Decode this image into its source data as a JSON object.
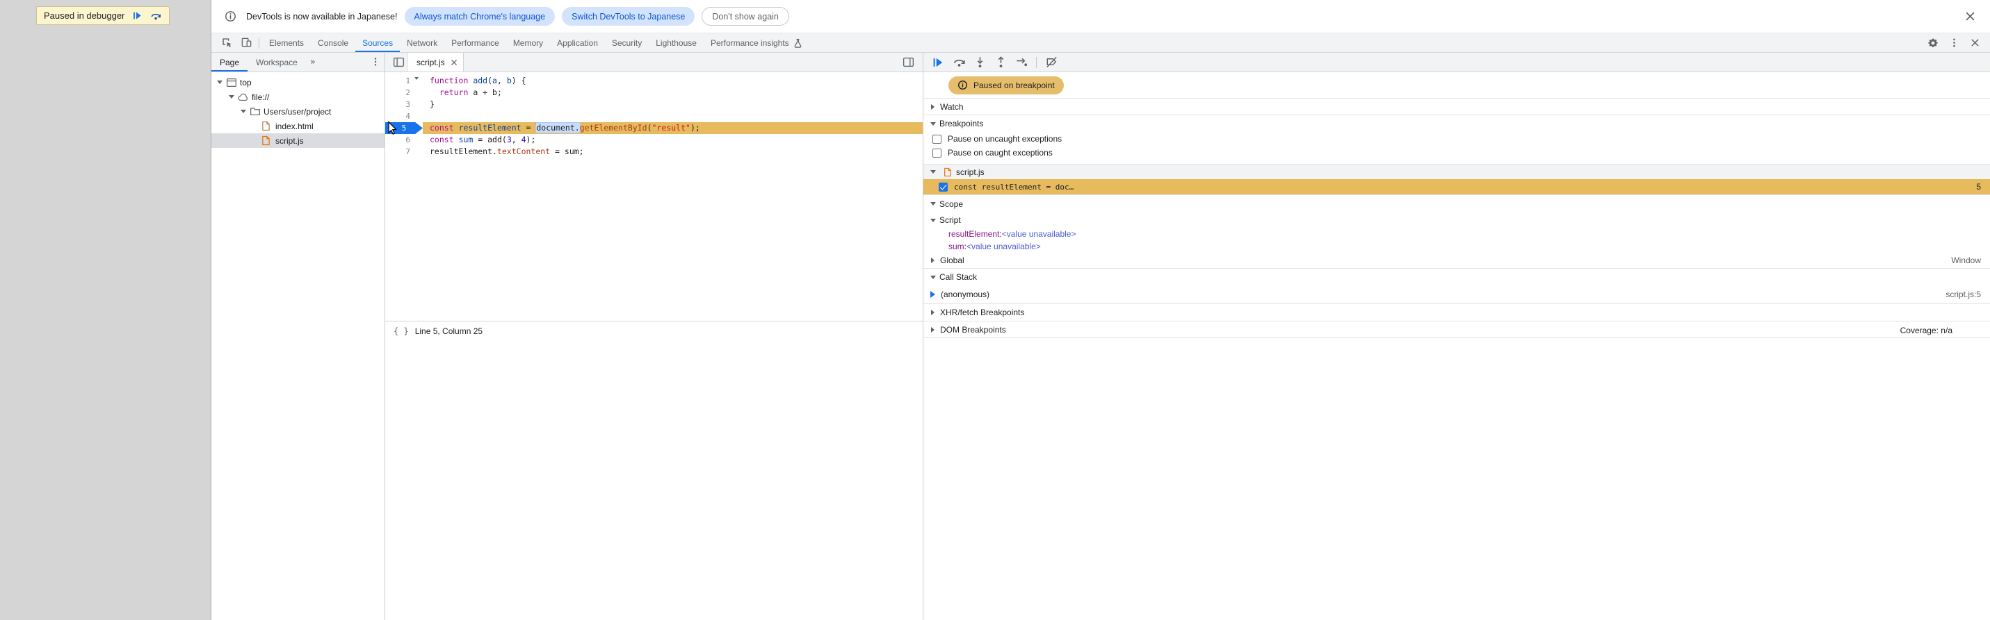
{
  "page": {
    "paused_banner_text": "Paused in debugger"
  },
  "infobar": {
    "message": "DevTools is now available in Japanese!",
    "buttons": [
      {
        "label": "Always match Chrome's language"
      },
      {
        "label": "Switch DevTools to Japanese"
      },
      {
        "label": "Don't show again"
      }
    ]
  },
  "toolbar": {
    "tabs": [
      "Elements",
      "Console",
      "Sources",
      "Network",
      "Performance",
      "Memory",
      "Application",
      "Security",
      "Lighthouse",
      "Performance insights"
    ],
    "selected_tab": "Sources"
  },
  "navigator": {
    "tabs": [
      "Page",
      "Workspace"
    ],
    "selected_tab": "Page",
    "tree": [
      {
        "label": "top",
        "icon": "frame",
        "depth": 0,
        "expanded": true
      },
      {
        "label": "file://",
        "icon": "cloud",
        "depth": 1,
        "expanded": true
      },
      {
        "label": "Users/user/project",
        "icon": "folder",
        "depth": 2,
        "expanded": true
      },
      {
        "label": "index.html",
        "icon": "file",
        "icon_color": "#b08252",
        "depth": 3
      },
      {
        "label": "script.js",
        "icon": "file",
        "icon_color": "#e8710a",
        "depth": 3,
        "selected": true
      }
    ]
  },
  "editor": {
    "tab_label": "script.js",
    "status_line": "Line 5, Column 25",
    "coverage": "Coverage: n/a",
    "lines": [
      {
        "n": 1,
        "fold": true,
        "tokens": [
          [
            "function",
            "kw"
          ],
          [
            " ",
            ""
          ],
          [
            "add",
            "def"
          ],
          [
            "(",
            ""
          ],
          [
            "a",
            "def"
          ],
          [
            ", ",
            ""
          ],
          [
            "b",
            "def"
          ],
          [
            ") {",
            ""
          ]
        ]
      },
      {
        "n": 2,
        "tokens": [
          [
            "  ",
            ""
          ],
          [
            "return",
            "kw"
          ],
          [
            " a + b;",
            ""
          ]
        ]
      },
      {
        "n": 3,
        "tokens": [
          [
            "}",
            ""
          ]
        ]
      },
      {
        "n": 4,
        "tokens": []
      },
      {
        "n": 5,
        "current": true,
        "breakpoint": true,
        "tokens": [
          [
            "const",
            "kw"
          ],
          [
            " ",
            ""
          ],
          [
            "resultElement",
            "def"
          ],
          [
            " = ",
            ""
          ],
          [
            "",
            "caret"
          ],
          [
            "document.",
            "hl"
          ],
          [
            "getElementById",
            "prop"
          ],
          [
            "(",
            ""
          ],
          [
            "\"result\"",
            "str"
          ],
          [
            ");",
            ""
          ]
        ]
      },
      {
        "n": 6,
        "tokens": [
          [
            "const",
            "kw"
          ],
          [
            " ",
            ""
          ],
          [
            "sum",
            "def"
          ],
          [
            " = add(",
            ""
          ],
          [
            "3",
            "num"
          ],
          [
            ", ",
            ""
          ],
          [
            "4",
            "num"
          ],
          [
            ");",
            ""
          ]
        ]
      },
      {
        "n": 7,
        "tokens": [
          [
            "resultElement",
            ""
          ],
          [
            ".",
            ""
          ],
          [
            "textContent",
            "prop"
          ],
          [
            " = sum;",
            ""
          ]
        ]
      }
    ]
  },
  "dbg": {
    "paused_badge": "Paused on breakpoint",
    "watch": "Watch",
    "breakpoints": "Breakpoints",
    "pause_uncaught": "Pause on uncaught exceptions",
    "pause_caught": "Pause on caught exceptions",
    "group_file": "script.js",
    "bp_snippet": "const resultElement = doc…",
    "bp_line": "5",
    "scope": "Scope",
    "scope_script": "Script",
    "vars": [
      {
        "name": "resultElement",
        "colon": ": ",
        "value": "<value unavailable>"
      },
      {
        "name": "sum",
        "colon": ": ",
        "value": "<value unavailable>"
      }
    ],
    "global": "Global",
    "global_value": "Window",
    "call_stack": "Call Stack",
    "frame_name": "(anonymous)",
    "frame_location": "script.js:5",
    "xhr": "XHR/fetch Breakpoints",
    "dom": "DOM Breakpoints"
  },
  "colors": {
    "accent": "#1a73e8",
    "paused_line": "#e7ba5e",
    "badge": "#e6bd6a"
  }
}
